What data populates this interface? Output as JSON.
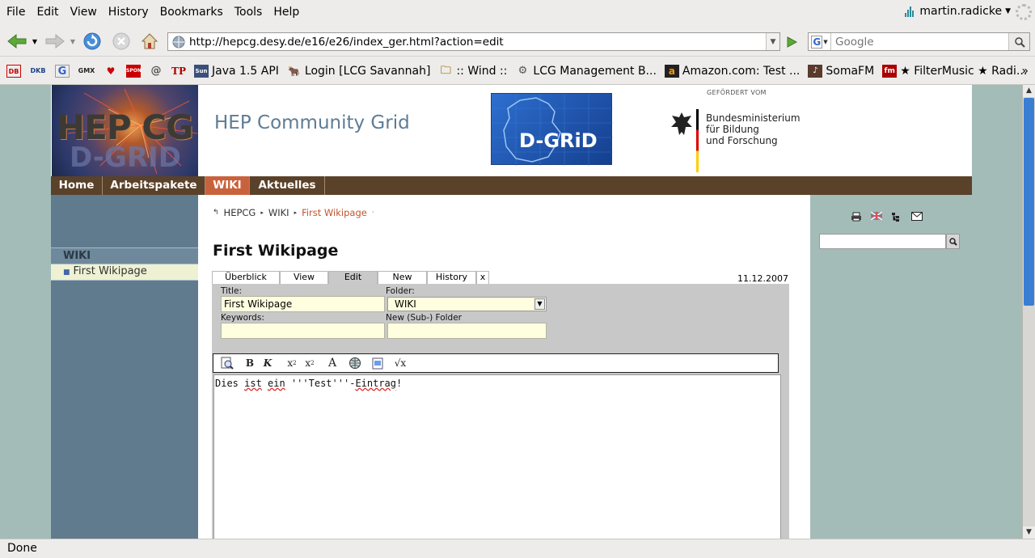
{
  "menu": [
    "File",
    "Edit",
    "View",
    "History",
    "Bookmarks",
    "Tools",
    "Help"
  ],
  "user": {
    "name": "martin.radicke"
  },
  "nav": {
    "url": "http://hepcg.desy.de/e16/e26/index_ger.html?action=edit",
    "search_placeholder": "Google",
    "search_engine_icon": "G"
  },
  "bookmarks": [
    {
      "icon": "DB",
      "label": ""
    },
    {
      "icon": "DKB",
      "label": ""
    },
    {
      "icon": "G",
      "label": ""
    },
    {
      "icon": "GMX",
      "label": ""
    },
    {
      "icon": "♥",
      "label": ""
    },
    {
      "icon": "SPON",
      "label": ""
    },
    {
      "icon": "@",
      "label": ""
    },
    {
      "icon": "TP",
      "label": ""
    },
    {
      "icon": "Sun",
      "label": "Java 1.5 API"
    },
    {
      "icon": "🐂",
      "label": "Login [LCG Savannah]"
    },
    {
      "icon": "🗀",
      "label": ":: Wind ::"
    },
    {
      "icon": "⚙",
      "label": "LCG Management B..."
    },
    {
      "icon": "a",
      "label": "Amazon.com: Test ..."
    },
    {
      "icon": "♪",
      "label": "SomaFM"
    },
    {
      "icon": "fm",
      "label": "★ FilterMusic ★ Radi..."
    }
  ],
  "bookmarks_more": "»",
  "status": "Done",
  "site": {
    "logo_line1": "HEP CG",
    "logo_line2": "D-GRID",
    "title": "HEP Community Grid",
    "dgrid_logo": "D-GRiD",
    "sponsor_small": "GEFÖRDERT VOM",
    "sponsor_name": "Bundesministerium für Bildung und Forschung",
    "sponsor_line1": "Bundesministerium",
    "sponsor_line2": "für Bildung",
    "sponsor_line3": "und Forschung",
    "nav": [
      {
        "label": "Home",
        "active": false
      },
      {
        "label": "Arbeitspakete",
        "active": false
      },
      {
        "label": "WIKI",
        "active": true
      },
      {
        "label": "Aktuelles",
        "active": false
      }
    ],
    "left": {
      "section": "WIKI",
      "item": "First Wikipage"
    },
    "breadcrumb": [
      "HEPCG",
      "WIKI",
      "First Wikipage"
    ],
    "page_title": "First Wikipage",
    "tabs": [
      "Überblick",
      "View",
      "Edit",
      "New",
      "History",
      "x"
    ],
    "active_tab": "Edit",
    "date": "11.12.2007",
    "form": {
      "title_label": "Title:",
      "title_value": "First Wikipage",
      "folder_label": "Folder:",
      "folder_value": "WIKI",
      "keywords_label": "Keywords:",
      "keywords_value": "",
      "newfolder_label": "New (Sub-) Folder",
      "newfolder_value": ""
    },
    "editor_toolbar": [
      "preview-icon",
      "bold-icon",
      "italic-icon",
      "subscript-icon",
      "superscript-icon",
      "font-icon",
      "link-icon",
      "image-icon",
      "formula-icon"
    ],
    "editor_text_parts": [
      "Dies ",
      "ist",
      " ",
      "ein",
      " '''Test'''-",
      "Eintrag",
      "!"
    ]
  }
}
